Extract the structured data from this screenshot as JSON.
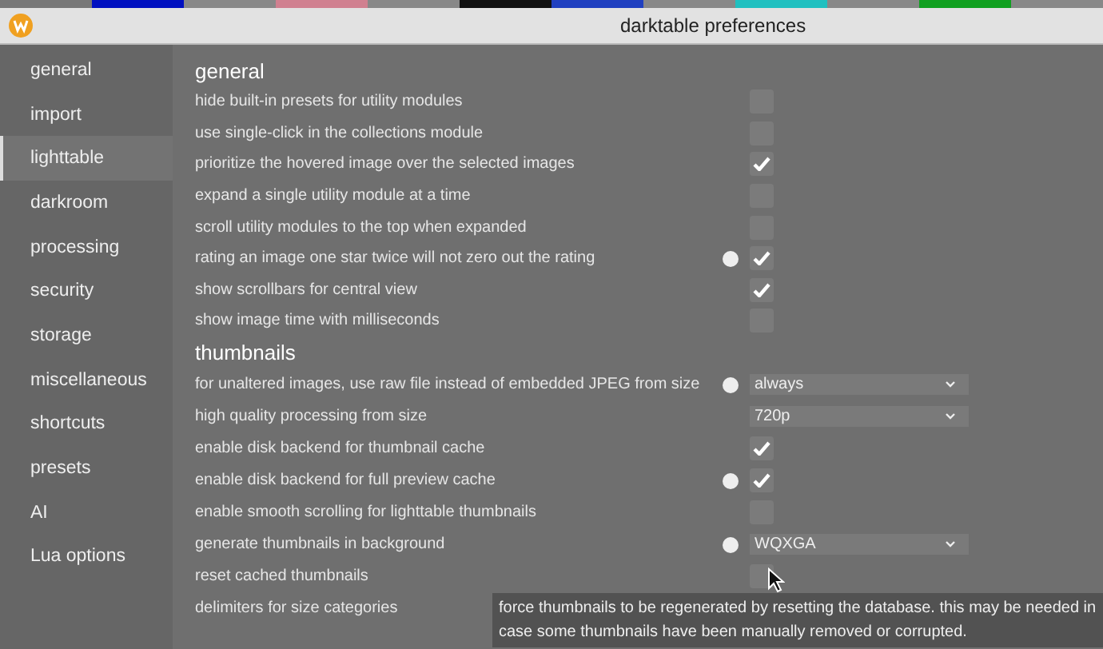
{
  "window": {
    "title": "darktable preferences"
  },
  "sidebar": {
    "items": [
      {
        "label": "general",
        "selected": false
      },
      {
        "label": "import",
        "selected": false
      },
      {
        "label": "lighttable",
        "selected": true
      },
      {
        "label": "darkroom",
        "selected": false
      },
      {
        "label": "processing",
        "selected": false
      },
      {
        "label": "security",
        "selected": false
      },
      {
        "label": "storage",
        "selected": false
      },
      {
        "label": "miscellaneous",
        "selected": false
      },
      {
        "label": "shortcuts",
        "selected": false
      },
      {
        "label": "presets",
        "selected": false
      },
      {
        "label": "AI",
        "selected": false
      },
      {
        "label": "Lua options",
        "selected": false
      }
    ]
  },
  "sections": [
    {
      "title": "general",
      "rows": [
        {
          "label": "hide built-in presets for utility modules",
          "kind": "checkbox",
          "checked": false,
          "modified": false
        },
        {
          "label": "use single-click in the collections module",
          "kind": "checkbox",
          "checked": false,
          "modified": false
        },
        {
          "label": "prioritize the hovered image over the selected images",
          "kind": "checkbox",
          "checked": true,
          "modified": false
        },
        {
          "label": "expand a single utility module at a time",
          "kind": "checkbox",
          "checked": false,
          "modified": false
        },
        {
          "label": "scroll utility modules to the top when expanded",
          "kind": "checkbox",
          "checked": false,
          "modified": false
        },
        {
          "label": "rating an image one star twice will not zero out the rating",
          "kind": "checkbox",
          "checked": true,
          "modified": true
        },
        {
          "label": "show scrollbars for central view",
          "kind": "checkbox",
          "checked": true,
          "modified": false
        },
        {
          "label": "show image time with milliseconds",
          "kind": "checkbox",
          "checked": false,
          "modified": false
        }
      ]
    },
    {
      "title": "thumbnails",
      "rows": [
        {
          "label": "for unaltered images, use raw file instead of embedded JPEG from size",
          "kind": "dropdown",
          "value": "always",
          "modified": true
        },
        {
          "label": "high quality processing from size",
          "kind": "dropdown",
          "value": "720p",
          "modified": false
        },
        {
          "label": "enable disk backend for thumbnail cache",
          "kind": "checkbox",
          "checked": true,
          "modified": false
        },
        {
          "label": "enable disk backend for full preview cache",
          "kind": "checkbox",
          "checked": true,
          "modified": true
        },
        {
          "label": "enable smooth scrolling for lighttable thumbnails",
          "kind": "checkbox",
          "checked": false,
          "modified": false
        },
        {
          "label": "generate thumbnails in background",
          "kind": "dropdown",
          "value": "WQXGA",
          "modified": true
        },
        {
          "label": "reset cached thumbnails",
          "kind": "button",
          "modified": false
        },
        {
          "label": "delimiters for size categories",
          "kind": "none",
          "modified": false
        }
      ]
    }
  ],
  "tooltip": {
    "text": "force thumbnails to be regenerated by resetting the database. this may be needed in case some thumbnails have been manually removed or corrupted."
  }
}
